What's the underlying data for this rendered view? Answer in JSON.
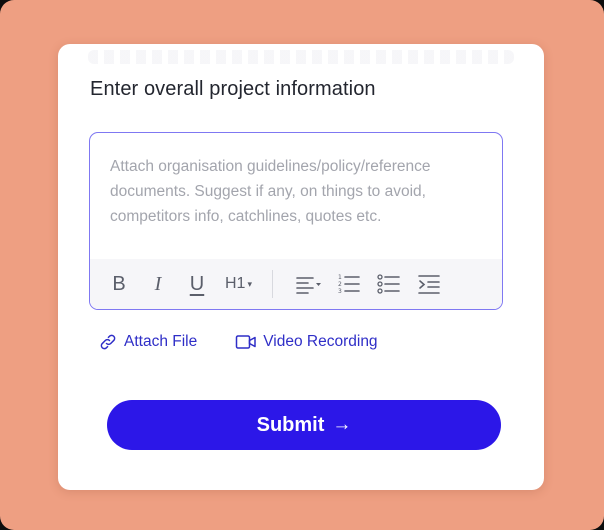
{
  "form": {
    "title": "Enter overall project information",
    "description_placeholder": "Attach organisation guidelines/policy/reference documents. Suggest if any, on things to avoid, competitors info, catchlines, quotes etc.",
    "submit_label": "Submit",
    "submit_arrow": "→"
  },
  "toolbar": {
    "bold": "B",
    "italic": "I",
    "underline": "U",
    "heading": "H1",
    "heading_caret": "▾",
    "icons": [
      "align-left-dropdown-icon",
      "numbered-list-icon",
      "bulleted-list-icon",
      "indent-icon"
    ]
  },
  "attachments": {
    "attach_file_label": "Attach File",
    "video_recording_label": "Video Recording"
  },
  "colors": {
    "background": "#ee9f82",
    "accent": "#2c17e8",
    "link": "#2f2ec7",
    "editor_border": "#7f78f2"
  }
}
